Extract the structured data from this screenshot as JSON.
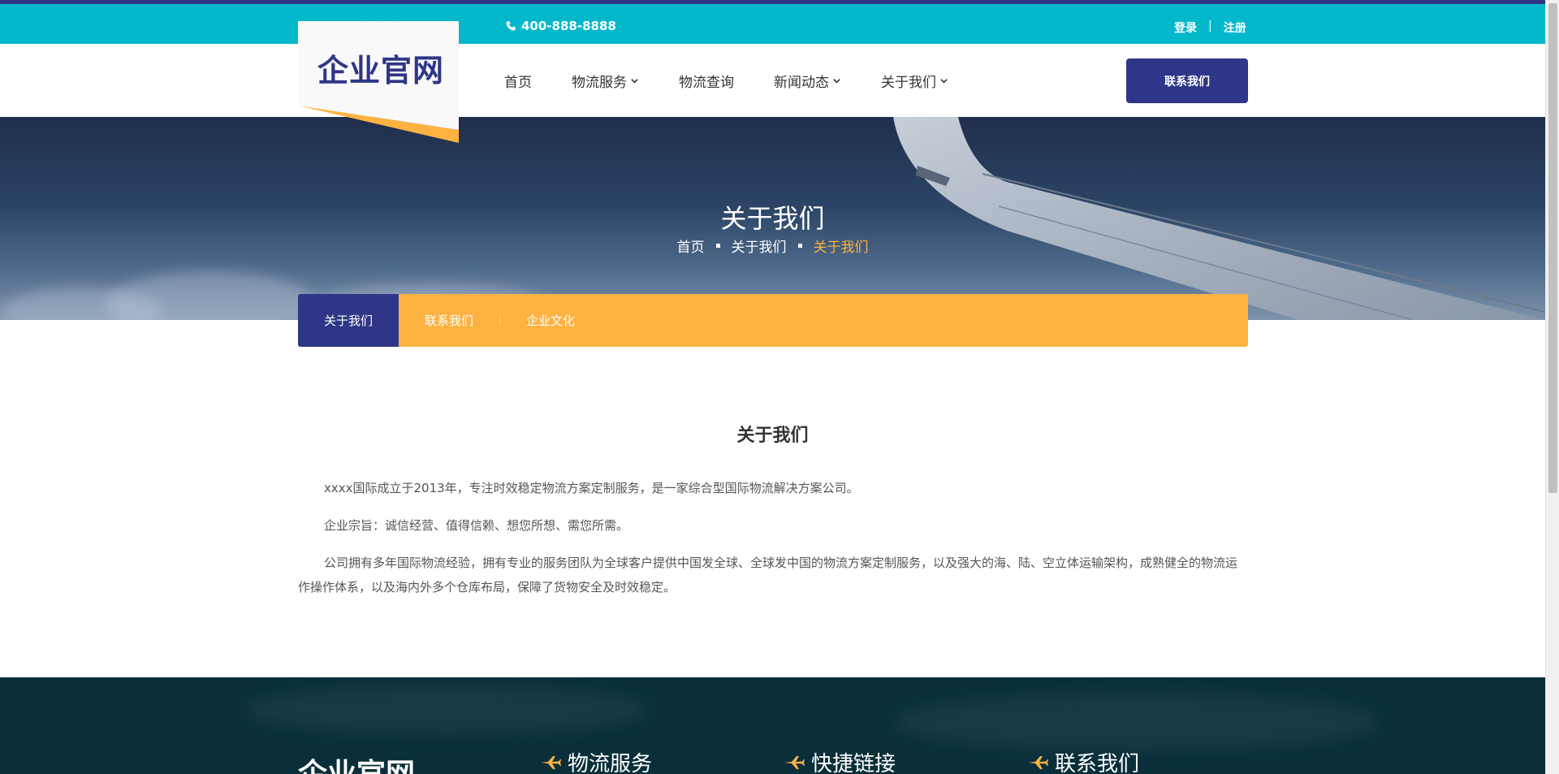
{
  "colors": {
    "brand_blue": "#2f3687",
    "teal": "#04b8cc",
    "orange": "#fdb242",
    "footer_bg": "#0a2f3a"
  },
  "topbar": {
    "phone": "400-888-8888",
    "phone_icon": "phone-icon",
    "login": "登录",
    "separator": "|",
    "register": "注册"
  },
  "header": {
    "logo": "企业官网",
    "nav": [
      "首页",
      "物流服务",
      "物流查询",
      "新闻动态",
      "关于我们"
    ],
    "contact_button": "联系我们"
  },
  "hero": {
    "title": "关于我们",
    "breadcrumb": [
      "首页",
      "关于我们",
      "关于我们"
    ]
  },
  "subtabs": [
    "关于我们",
    "联系我们",
    "企业文化"
  ],
  "content": {
    "title": "关于我们",
    "paragraphs": [
      "xxxx国际成立于2013年，专注时效稳定物流方案定制服务，是一家综合型国际物流解决方案公司。",
      "企业宗旨：诚信经营、值得信赖、想您所想、需您所需。",
      "公司拥有多年国际物流经验，拥有专业的服务团队为全球客户提供中国发全球、全球发中国的物流方案定制服务，以及强大的海、陆、空立体运输架构，成熟健全的物流运作操作体系，以及海内外多个仓库布局，保障了货物安全及时效稳定。"
    ]
  },
  "footer": {
    "logo": "企业官网",
    "columns": [
      "物流服务",
      "快捷链接",
      "联系我们"
    ]
  }
}
